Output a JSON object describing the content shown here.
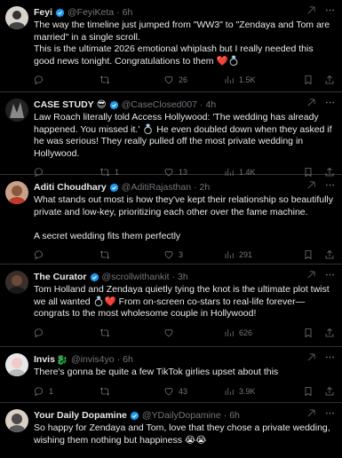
{
  "tweets": [
    {
      "name": "Feyi",
      "handle": "@FeyiKeta",
      "time": "6h",
      "verified": true,
      "name_emoji": "",
      "body": [
        "The way the timeline just jumped from \"WW3\" to \"Zendaya and Tom are married\" in a single scroll.",
        "This is the ultimate 2026 emotional whiplash but I really needed this good news tonight. Congratulations to them ❤️💍"
      ],
      "replies": "",
      "retweets": "",
      "likes": "26",
      "views": "1.5K"
    },
    {
      "name": "CASE STUDY",
      "handle": "@CaseClosed007",
      "time": "4h",
      "verified": true,
      "name_emoji": "😎",
      "body": [
        "Law Roach literally told Access Hollywood: 'The wedding has already happened. You missed it.' 💍 He even doubled down when they asked if he was serious! They really pulled off the most private wedding in Hollywood."
      ],
      "replies": "",
      "retweets": "1",
      "likes": "13",
      "views": "1.4K"
    },
    {
      "name": "Aditi Choudhary",
      "handle": "@AditiRajasthan",
      "time": "2h",
      "verified": true,
      "name_emoji": "",
      "body": [
        "What stands out most is how they've kept their relationship so beautifully private and low-key, prioritizing each other over the fame machine.",
        "",
        "A secret wedding fits them perfectly"
      ],
      "replies": "",
      "retweets": "",
      "likes": "3",
      "views": "291"
    },
    {
      "name": "The Curator",
      "handle": "@scrollwithankit",
      "time": "3h",
      "verified": true,
      "name_emoji": "",
      "body": [
        "Tom Holland and Zendaya quietly tying the knot is the ultimate plot twist we all wanted 💍❤️ From on-screen co-stars to real-life forever—congrats to the most wholesome couple in Hollywood!"
      ],
      "replies": "",
      "retweets": "",
      "likes": "",
      "views": "626"
    },
    {
      "name": "Invis",
      "handle": "@invis4yo",
      "time": "6h",
      "verified": false,
      "name_emoji": "🐉",
      "body": [
        "There's gonna be quite a few TikTok girlies upset about this"
      ],
      "replies": "1",
      "retweets": "",
      "likes": "43",
      "views": "3.9K"
    },
    {
      "name": "Your Daily Dopamine",
      "handle": "@YDailyDopamine",
      "time": "6h",
      "verified": true,
      "name_emoji": "",
      "body": [
        "So happy for Zendaya and Tom, love that they chose a private wedding, wishing them nothing but happiness 😭😭"
      ],
      "replies": "",
      "retweets": "",
      "likes": "",
      "views": ""
    }
  ],
  "colors": {
    "background": "#000000",
    "text": "#e7e9ea",
    "muted": "#71767b",
    "verified": "#1d9bf0",
    "divider": "#2f3336"
  },
  "icons": {
    "reply": "reply-icon",
    "retweet": "retweet-icon",
    "like": "heart-icon",
    "views": "views-icon",
    "bookmark": "bookmark-icon",
    "share": "share-icon",
    "grok": "grok-icon",
    "more": "more-icon"
  }
}
